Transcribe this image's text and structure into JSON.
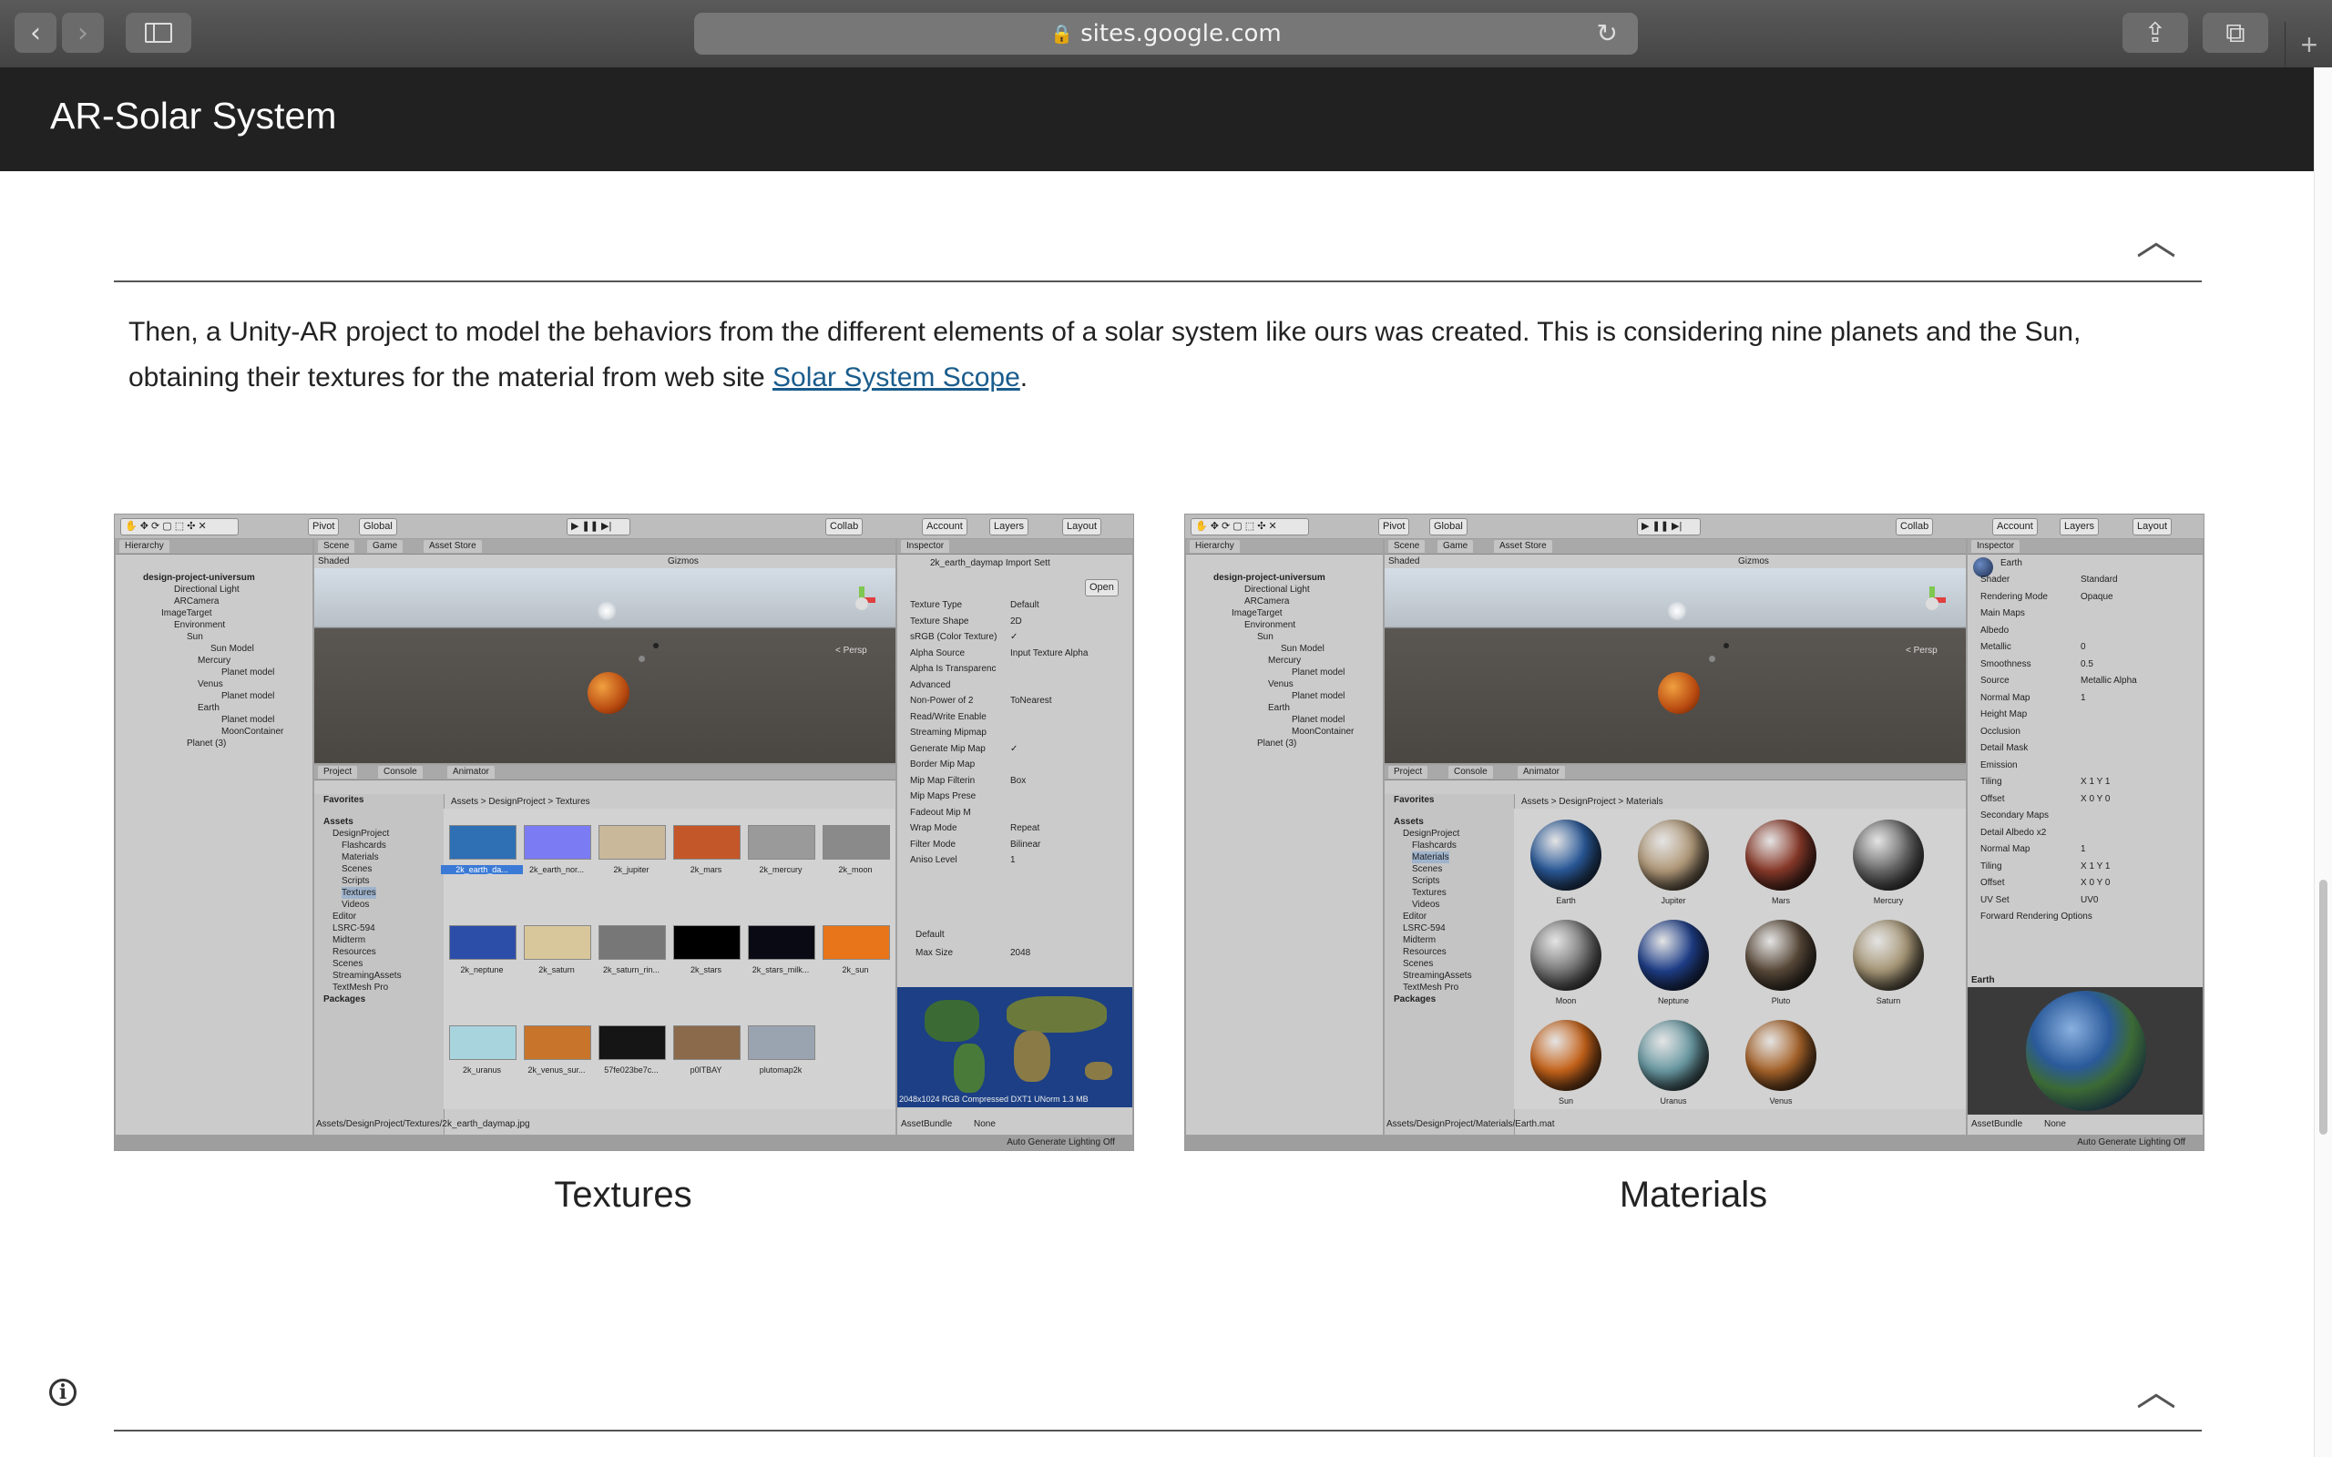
{
  "browser": {
    "url": "sites.google.com",
    "back_icon": "chevron-left",
    "forward_icon": "chevron-right",
    "sidebar_icon": "sidebar",
    "reload_icon": "reload",
    "share_icon": "share",
    "tabs_icon": "tabs",
    "new_tab_icon": "plus"
  },
  "site": {
    "title": "AR-Solar System"
  },
  "content": {
    "paragraph_before_link": "Then, a Unity-AR project to model the behaviors from the different elements of a solar system like ours was created. This is considering nine planets and the Sun, obtaining their textures for the material from web site ",
    "link_text": "Solar System Scope",
    "paragraph_after_link": "."
  },
  "figures": [
    {
      "caption": "Textures",
      "hierarchy_root": "design-project-universum",
      "project_path": "Assets > DesignProject > Textures",
      "inspector_title": "2k_earth_daymap Import Sett",
      "inspector_props": [
        {
          "label": "Texture Type",
          "value": "Default"
        },
        {
          "label": "Texture Shape",
          "value": "2D"
        },
        {
          "label": "sRGB (Color Texture)",
          "value": "✓"
        },
        {
          "label": "Alpha Source",
          "value": "Input Texture Alpha"
        },
        {
          "label": "Alpha Is Transparenc",
          "value": ""
        },
        {
          "label": "Advanced",
          "value": ""
        },
        {
          "label": "Non-Power of 2",
          "value": "ToNearest"
        },
        {
          "label": "Read/Write Enable",
          "value": ""
        },
        {
          "label": "Streaming Mipmap",
          "value": ""
        },
        {
          "label": "Generate Mip Map",
          "value": "✓"
        },
        {
          "label": "Border Mip Map",
          "value": ""
        },
        {
          "label": "Mip Map Filterin",
          "value": "Box"
        },
        {
          "label": "Mip Maps Prese",
          "value": ""
        },
        {
          "label": "Fadeout Mip M",
          "value": ""
        },
        {
          "label": "Wrap Mode",
          "value": "Repeat"
        },
        {
          "label": "Filter Mode",
          "value": "Bilinear"
        },
        {
          "label": "Aniso Level",
          "value": "1"
        }
      ],
      "thumbs": [
        {
          "label": "2k_earth_da...",
          "color": "#2f6fb4"
        },
        {
          "label": "2k_earth_nor...",
          "color": "#7b7bf4"
        },
        {
          "label": "2k_jupiter",
          "color": "#c9b89a"
        },
        {
          "label": "2k_mars",
          "color": "#c4572a"
        },
        {
          "label": "2k_mercury",
          "color": "#9a9a9a"
        },
        {
          "label": "2k_moon",
          "color": "#8a8a8a"
        },
        {
          "label": "2k_neptune",
          "color": "#2d4ea8"
        },
        {
          "label": "2k_saturn",
          "color": "#d8c79a"
        },
        {
          "label": "2k_saturn_rin...",
          "color": "#777777"
        },
        {
          "label": "2k_stars",
          "color": "#000000"
        },
        {
          "label": "2k_stars_milk...",
          "color": "#0a0a14"
        },
        {
          "label": "2k_sun",
          "color": "#e8751a"
        },
        {
          "label": "2k_uranus",
          "color": "#a8d4de"
        },
        {
          "label": "2k_venus_sur...",
          "color": "#c8742a"
        },
        {
          "label": "57fe023be7c...",
          "color": "#151515"
        },
        {
          "label": "p0lTBAY",
          "color": "#8a6a4a"
        },
        {
          "label": "plutomap2k",
          "color": "#9aa4b0"
        }
      ],
      "bottom_path": "Assets/DesignProject/Textures/2k_earth_daymap.jpg"
    },
    {
      "caption": "Materials",
      "hierarchy_root": "design-project-universum",
      "project_path": "Assets > DesignProject > Materials",
      "inspector_title": "Earth",
      "inspector_props": [
        {
          "label": "Shader",
          "value": "Standard"
        },
        {
          "label": "Rendering Mode",
          "value": "Opaque"
        },
        {
          "label": "Main Maps",
          "value": ""
        },
        {
          "label": "Albedo",
          "value": ""
        },
        {
          "label": "Metallic",
          "value": "0"
        },
        {
          "label": "Smoothness",
          "value": "0.5"
        },
        {
          "label": "Source",
          "value": "Metallic Alpha"
        },
        {
          "label": "Normal Map",
          "value": "1"
        },
        {
          "label": "Height Map",
          "value": ""
        },
        {
          "label": "Occlusion",
          "value": ""
        },
        {
          "label": "Detail Mask",
          "value": ""
        },
        {
          "label": "Emission",
          "value": ""
        },
        {
          "label": "Tiling",
          "value": "X 1  Y 1"
        },
        {
          "label": "Offset",
          "value": "X 0  Y 0"
        },
        {
          "label": "Secondary Maps",
          "value": ""
        },
        {
          "label": "Detail Albedo x2",
          "value": ""
        },
        {
          "label": "Normal Map",
          "value": "1"
        },
        {
          "label": "Tiling",
          "value": "X 1  Y 1"
        },
        {
          "label": "Offset",
          "value": "X 0  Y 0"
        },
        {
          "label": "UV Set",
          "value": "UV0"
        },
        {
          "label": "Forward Rendering Options",
          "value": ""
        }
      ],
      "spheres": [
        {
          "label": "Earth",
          "color": "#2a5a9a"
        },
        {
          "label": "Jupiter",
          "color": "#b29a7a"
        },
        {
          "label": "Mars",
          "color": "#8a3a2a"
        },
        {
          "label": "Mercury",
          "color": "#6a6a6a"
        },
        {
          "label": "Moon",
          "color": "#7a7a7a"
        },
        {
          "label": "Neptune",
          "color": "#1f3f8a"
        },
        {
          "label": "Pluto",
          "color": "#5a4a3a"
        },
        {
          "label": "Saturn",
          "color": "#a89878"
        },
        {
          "label": "Sun",
          "color": "#c8641a"
        },
        {
          "label": "Uranus",
          "color": "#6a9aa4"
        },
        {
          "label": "Venus",
          "color": "#a8642a"
        }
      ],
      "preview_label": "Earth",
      "bottom_path": "Assets/DesignProject/Materials/Earth.mat"
    }
  ],
  "unity": {
    "toolbar": [
      "Pivot",
      "Global",
      "Collab",
      "Account",
      "Layers",
      "Layout"
    ],
    "tabs_scene": [
      "Scene",
      "Game",
      "Asset Store"
    ],
    "shading": "Shaded",
    "gizmos": "Gizmos",
    "persp": "< Persp",
    "hierarchy_title": "Hierarchy",
    "hierarchy_items": [
      "Directional Light",
      "ARCamera",
      "ImageTarget",
      "Environment",
      "Sun",
      "Sun Model",
      "Mercury",
      "Planet model",
      "Venus",
      "Planet model",
      "Earth",
      "Planet model",
      "MoonContainer",
      "Planet (3)"
    ],
    "project_tabs": [
      "Project",
      "Console",
      "Animator"
    ],
    "favorites": "Favorites",
    "project_tree": [
      "Assets",
      "DesignProject",
      "Flashcards",
      "Materials",
      "Scenes",
      "Scripts",
      "Textures",
      "Videos",
      "Editor",
      "LSRC-594",
      "Midterm",
      "Resources",
      "Scenes",
      "StreamingAssets",
      "TextMesh Pro",
      "Packages"
    ],
    "inspector_tab": "Inspector",
    "asset_bundle": "AssetBundle",
    "none": "None",
    "status": "Auto Generate Lighting Off",
    "open_button": "Open",
    "default_label": "Default",
    "max_size": "Max Size",
    "max_size_value": "2048",
    "tex_info": "2048x1024 RGB Compressed DXT1 UNorm  1.3 MB"
  }
}
